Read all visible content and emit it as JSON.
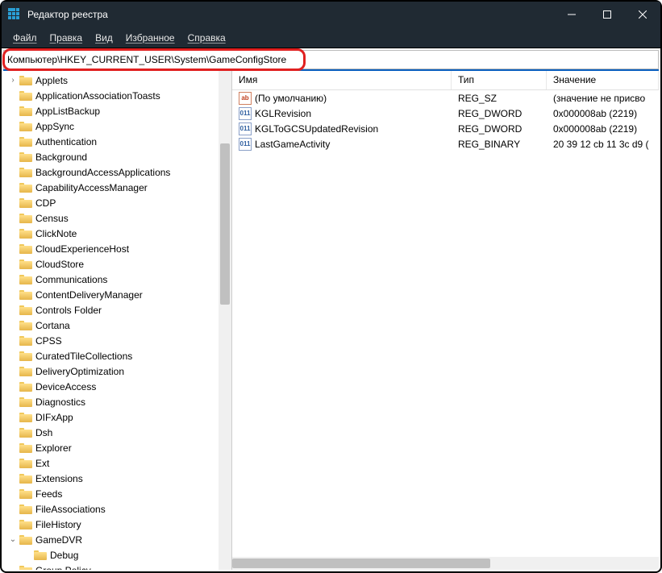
{
  "window": {
    "title": "Редактор реестра"
  },
  "menu": {
    "file": "Файл",
    "edit": "Правка",
    "view": "Вид",
    "favorites": "Избранное",
    "help": "Справка"
  },
  "address": {
    "path": "Компьютер\\HKEY_CURRENT_USER\\System\\GameConfigStore"
  },
  "tree": {
    "items": [
      {
        "label": "Applets",
        "chev": ">"
      },
      {
        "label": "ApplicationAssociationToasts"
      },
      {
        "label": "AppListBackup"
      },
      {
        "label": "AppSync"
      },
      {
        "label": "Authentication"
      },
      {
        "label": "Background"
      },
      {
        "label": "BackgroundAccessApplications"
      },
      {
        "label": "CapabilityAccessManager"
      },
      {
        "label": "CDP"
      },
      {
        "label": "Census"
      },
      {
        "label": "ClickNote"
      },
      {
        "label": "CloudExperienceHost"
      },
      {
        "label": "CloudStore"
      },
      {
        "label": "Communications"
      },
      {
        "label": "ContentDeliveryManager"
      },
      {
        "label": "Controls Folder"
      },
      {
        "label": "Cortana"
      },
      {
        "label": "CPSS"
      },
      {
        "label": "CuratedTileCollections"
      },
      {
        "label": "DeliveryOptimization"
      },
      {
        "label": "DeviceAccess"
      },
      {
        "label": "Diagnostics"
      },
      {
        "label": "DIFxApp"
      },
      {
        "label": "Dsh"
      },
      {
        "label": "Explorer"
      },
      {
        "label": "Ext"
      },
      {
        "label": "Extensions"
      },
      {
        "label": "Feeds"
      },
      {
        "label": "FileAssociations"
      },
      {
        "label": "FileHistory"
      },
      {
        "label": "GameDVR",
        "chev": "v"
      },
      {
        "label": "Debug",
        "indent": 1
      },
      {
        "label": "Group Policy"
      }
    ]
  },
  "list": {
    "headers": {
      "name": "Имя",
      "type": "Тип",
      "value": "Значение"
    },
    "rows": [
      {
        "icon": "str",
        "name": "(По умолчанию)",
        "type": "REG_SZ",
        "value": "(значение не присво"
      },
      {
        "icon": "bin",
        "name": "KGLRevision",
        "type": "REG_DWORD",
        "value": "0x000008ab (2219)"
      },
      {
        "icon": "bin",
        "name": "KGLToGCSUpdatedRevision",
        "type": "REG_DWORD",
        "value": "0x000008ab (2219)"
      },
      {
        "icon": "bin",
        "name": "LastGameActivity",
        "type": "REG_BINARY",
        "value": "20 39 12 cb 11 3c d9 ("
      }
    ]
  }
}
